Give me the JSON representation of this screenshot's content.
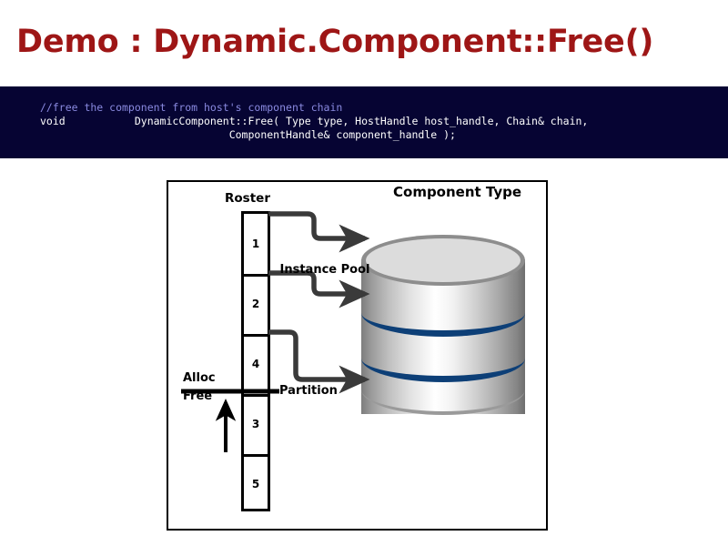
{
  "slide": {
    "title": "Demo : Dynamic.Component::Free()",
    "title_color": "#9E1616",
    "background_color": "#ffffff"
  },
  "code": {
    "background_color": "#060433",
    "comment_color": "#8A8AE0",
    "text_color": "#ffffff",
    "comment": "//free the component from host's component chain",
    "line_1": "void           DynamicComponent::Free( Type type, HostHandle host_handle, Chain& chain,",
    "line_2": "                              ComponentHandle& component_handle );"
  },
  "diagram": {
    "roster_label": "Roster",
    "component_type_label": "Component Type",
    "instance_pool_label": "Instance Pool",
    "alloc_label": "Alloc",
    "free_label": "Free",
    "partition_label": "Partition",
    "roster_cells": [
      {
        "value": "1"
      },
      {
        "value": "2"
      },
      {
        "value": "4"
      },
      {
        "value": "3"
      },
      {
        "value": "5"
      }
    ],
    "band_color": "#0d3f77",
    "arrow_color": "#3a3a3a",
    "border_color": "#000000"
  }
}
